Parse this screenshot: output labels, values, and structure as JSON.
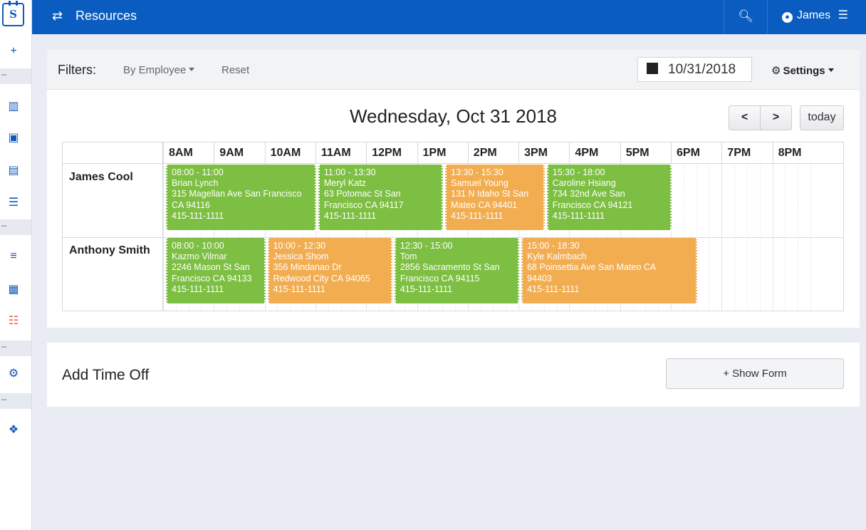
{
  "app": {
    "logo_text": "S"
  },
  "sidebar": {
    "items": [
      {
        "name": "add-icon",
        "glyph": "+"
      },
      {
        "name": "chart-icon",
        "glyph": "▥"
      },
      {
        "name": "contact-card-icon",
        "glyph": "▣"
      },
      {
        "name": "document-icon",
        "glyph": "▤"
      },
      {
        "name": "server-icon",
        "glyph": "☰"
      },
      {
        "name": "list-icon",
        "glyph": "≡"
      },
      {
        "name": "calendar-icon",
        "glyph": "▦"
      },
      {
        "name": "task-list-icon",
        "glyph": "☷"
      },
      {
        "name": "gears-icon",
        "glyph": "⚙"
      },
      {
        "name": "cubes-icon",
        "glyph": "❖"
      }
    ],
    "separator": "--"
  },
  "topbar": {
    "title": "Resources",
    "user": "James"
  },
  "filters": {
    "label": "Filters:",
    "by_employee": "By Employee",
    "reset": "Reset",
    "date": "10/31/2018",
    "settings": "Settings"
  },
  "calendar": {
    "day_title": "Wednesday, Oct 31 2018",
    "prev": "<",
    "next": ">",
    "today": "today",
    "hours": [
      "8AM",
      "9AM",
      "10AM",
      "11AM",
      "12PM",
      "1PM",
      "2PM",
      "3PM",
      "4PM",
      "5PM",
      "6PM",
      "7PM",
      "8PM"
    ],
    "rows": [
      {
        "name": "James Cool",
        "events": [
          {
            "start": 8,
            "end": 11,
            "color": "green",
            "time": "08:00 - 11:00",
            "who": "Brian Lynch",
            "addr1": "315 Magellan Ave San Francisco",
            "addr2": "CA 94116",
            "phone": "415-111-1111"
          },
          {
            "start": 11,
            "end": 13.5,
            "color": "green",
            "time": "11:00 - 13:30",
            "who": "Meryl Katz",
            "addr1": "63 Potomac St San",
            "addr2": "Francisco CA 94117",
            "phone": "415-111-1111"
          },
          {
            "start": 13.5,
            "end": 15.5,
            "color": "orange",
            "time": "13:30 - 15:30",
            "who": "Samuel Young",
            "addr1": "131 N Idaho St San",
            "addr2": "Mateo CA 94401",
            "phone": "415-111-1111"
          },
          {
            "start": 15.5,
            "end": 18,
            "color": "green",
            "time": "15:30 - 18:00",
            "who": "Caroline Hsiang",
            "addr1": "734 32nd Ave San",
            "addr2": "Francisco CA 94121",
            "phone": "415-111-1111"
          }
        ]
      },
      {
        "name": "Anthony Smith",
        "events": [
          {
            "start": 8,
            "end": 10,
            "color": "green",
            "time": "08:00 - 10:00",
            "who": "Kazmo Vilmar",
            "addr1": "2246 Mason St San",
            "addr2": "Francisco CA 94133",
            "phone": "415-111-1111"
          },
          {
            "start": 10,
            "end": 12.5,
            "color": "orange",
            "time": "10:00 - 12:30",
            "who": "Jessica Shom",
            "addr1": "356 Mindanao Dr",
            "addr2": "Redwood City CA 94065",
            "phone": "415-111-1111"
          },
          {
            "start": 12.5,
            "end": 15,
            "color": "green",
            "time": "12:30 - 15:00",
            "who": "Tom",
            "addr1": "2856 Sacramento St San",
            "addr2": "Francisco CA 94115",
            "phone": "415-111-1111"
          },
          {
            "start": 15,
            "end": 18.5,
            "color": "orange",
            "time": "15:00 - 18:30",
            "who": "Kyle Kalmbach",
            "addr1": "68 Poinsettia Ave San Mateo CA",
            "addr2": "94403",
            "phone": "415-111-1111"
          }
        ]
      }
    ]
  },
  "timeoff": {
    "title": "Add Time Off",
    "show_form": "+ Show Form"
  },
  "colors": {
    "brand": "#0b5cc0",
    "green": "#7dbf42",
    "orange": "#f2ad51"
  }
}
